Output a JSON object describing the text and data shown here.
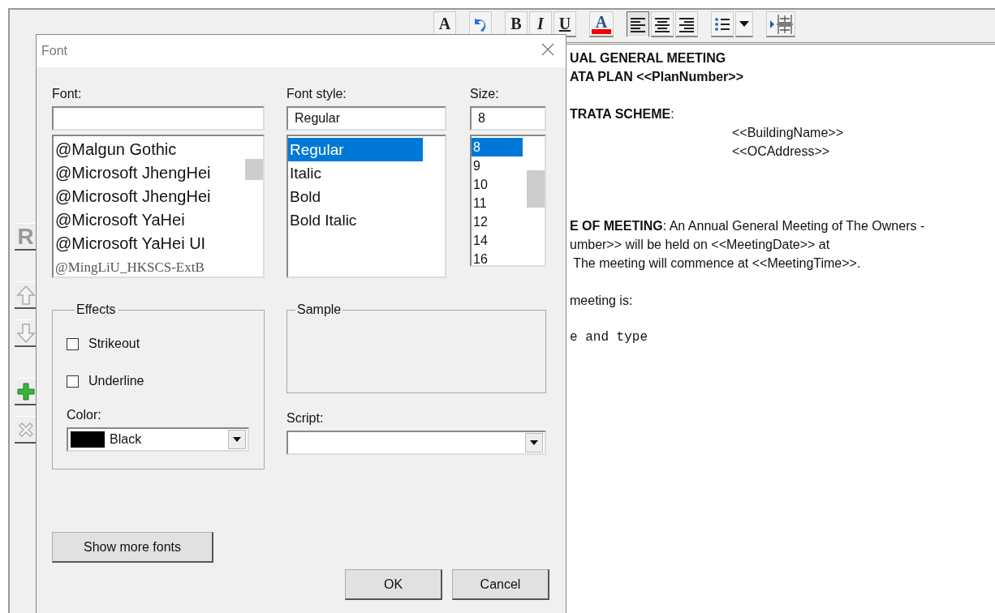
{
  "side_buttons": [
    {
      "kind": "text",
      "label": "R",
      "disabled": true
    },
    {
      "kind": "up",
      "disabled": true
    },
    {
      "kind": "down",
      "disabled": true
    },
    {
      "kind": "add",
      "disabled": false
    },
    {
      "kind": "delete",
      "disabled": true
    }
  ],
  "toolbar": [
    {
      "kind": "font",
      "label": "A",
      "pressed": false
    },
    {
      "kind": "undo",
      "pressed": false
    },
    {
      "kind": "bold",
      "label": "B",
      "pressed": false
    },
    {
      "kind": "italic",
      "label": "I",
      "pressed": false
    },
    {
      "kind": "underline",
      "label": "U",
      "pressed": false
    },
    {
      "kind": "color",
      "label": "A",
      "pressed": false
    },
    {
      "kind": "align-left",
      "pressed": true
    },
    {
      "kind": "align-center",
      "pressed": false
    },
    {
      "kind": "align-right",
      "pressed": false
    },
    {
      "kind": "list",
      "pressed": false
    },
    {
      "kind": "dropdown",
      "pressed": false
    },
    {
      "kind": "table",
      "pressed": false
    }
  ],
  "document": {
    "lines": [
      {
        "kind": "text",
        "text": "**UAL GENERAL MEETING**"
      },
      {
        "kind": "text",
        "text": "**ATA PLAN <<PlanNumber>>**"
      },
      {
        "kind": "blank"
      },
      {
        "kind": "text",
        "text": "**TRATA SCHEME**:"
      },
      {
        "kind": "indented",
        "text": "<<BuildingName>>"
      },
      {
        "kind": "indented",
        "text": "<<OCAddress>>"
      },
      {
        "kind": "blank"
      },
      {
        "kind": "blank"
      },
      {
        "kind": "blank"
      },
      {
        "kind": "text",
        "text": "**E OF MEETING**: An Annual General Meeting of The Owners -"
      },
      {
        "kind": "text",
        "text": "umber>> will be held on <<MeetingDate>> at"
      },
      {
        "kind": "text",
        "text": " The meeting will commence at <<MeetingTime>>."
      },
      {
        "kind": "blank"
      },
      {
        "kind": "text",
        "text": "meeting is:"
      },
      {
        "kind": "blank"
      },
      {
        "kind": "mono",
        "text": "e and type"
      }
    ]
  },
  "dialog": {
    "title": "Font",
    "font": {
      "label": "Font:",
      "items": [
        {
          "text": "@Malgun Gothic",
          "selected": false,
          "kind": "sans"
        },
        {
          "text": "@Microsoft JhengHei",
          "selected": false,
          "kind": "sans"
        },
        {
          "text": "@Microsoft JhengHei",
          "selected": false,
          "kind": "sans"
        },
        {
          "text": "@Microsoft YaHei",
          "selected": false,
          "kind": "sans"
        },
        {
          "text": "@Microsoft YaHei UI",
          "selected": false,
          "kind": "sans"
        },
        {
          "text": "@MingLiU_HKSCS-ExtB",
          "selected": false,
          "kind": "serif"
        }
      ]
    },
    "font_style": {
      "label": "Font style:",
      "value": "Regular",
      "items": [
        {
          "text": "Regular",
          "selected": true
        },
        {
          "text": "Italic",
          "selected": false
        },
        {
          "text": "Bold",
          "selected": false
        },
        {
          "text": "Bold Italic",
          "selected": false
        }
      ]
    },
    "size": {
      "label": "Size:",
      "value": "8",
      "items": [
        {
          "text": "8",
          "selected": true
        },
        {
          "text": "9",
          "selected": false
        },
        {
          "text": "10",
          "selected": false
        },
        {
          "text": "11",
          "selected": false
        },
        {
          "text": "12",
          "selected": false
        },
        {
          "text": "14",
          "selected": false
        },
        {
          "text": "16",
          "selected": false
        }
      ]
    },
    "effects": {
      "label": "Effects",
      "options": [
        {
          "label": "Strikeout",
          "checked": false
        },
        {
          "label": "Underline",
          "checked": false
        }
      ],
      "color_label": "Color:",
      "color": {
        "value": "Black",
        "color": "#000000"
      }
    },
    "sample": {
      "label": "Sample"
    },
    "script": {
      "label": "Script:"
    },
    "show_more": "Show more fonts",
    "buttons": [
      "OK",
      "Cancel"
    ]
  }
}
